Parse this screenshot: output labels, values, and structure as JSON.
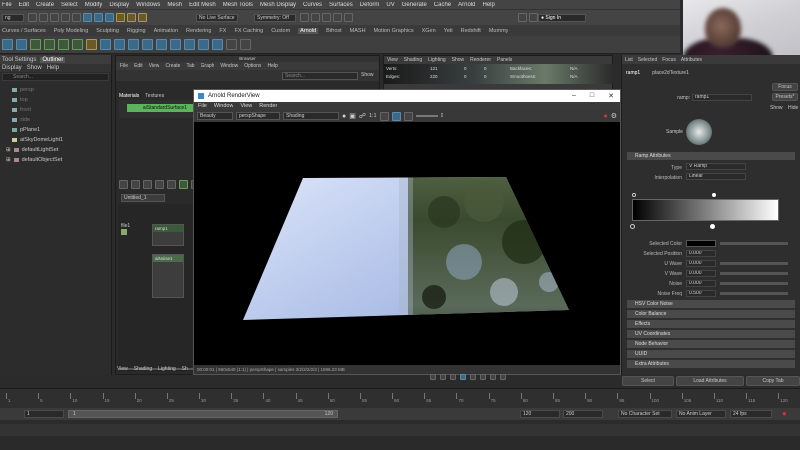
{
  "menubar": [
    "File",
    "Edit",
    "Create",
    "Select",
    "Modify",
    "Display",
    "Windows",
    "Mesh",
    "Edit Mesh",
    "Mesh Tools",
    "Mesh Display",
    "Curves",
    "Surfaces",
    "Deform",
    "UV",
    "Generate",
    "Cache",
    "Arnold",
    "Help"
  ],
  "status": {
    "workspace": "ng",
    "live_surface": "No Live Surface",
    "symmetry": "Symmetry: Off",
    "sign_in": "Sign In"
  },
  "shelf_tabs": [
    "Curves / Surfaces",
    "Poly Modeling",
    "Sculpting",
    "Rigging",
    "Animation",
    "Rendering",
    "FX",
    "FX Caching",
    "Custom",
    "Arnold",
    "Bifrost",
    "MASH",
    "Motion Graphics",
    "XGen",
    "Yeti",
    "Redshift",
    "Mummy"
  ],
  "shelf_active": "Arnold",
  "outliner": {
    "tabs": [
      "Tool Settings",
      "Outliner"
    ],
    "menu": [
      "Display",
      "Show",
      "Help"
    ],
    "search_placeholder": "Search...",
    "items": [
      "persp",
      "top",
      "front",
      "side",
      "pPlane1",
      "aiSkyDomeLight1",
      "defaultLightSet",
      "defaultObjectSet"
    ]
  },
  "hypershade": {
    "title": "Browser",
    "menu": [
      "File",
      "Edit",
      "View",
      "Create",
      "Tab",
      "Graph",
      "Window",
      "Options",
      "Help"
    ],
    "search_placeholder": "Search...",
    "show_label": "Show",
    "browser_tabs": [
      "Materials",
      "Textures"
    ],
    "material": "aiStandardSurface1",
    "graph_tab": "Untitled_1",
    "nodes": {
      "file": "file1",
      "ramp": "ramp1",
      "noise": "aiNoise1"
    }
  },
  "viewport": {
    "menu": [
      "View",
      "Shading",
      "Lighting",
      "Show",
      "Renderer",
      "Panels"
    ],
    "stats": [
      {
        "label": "Verts:",
        "a": "121",
        "b": "0",
        "c": "0",
        "d": "Backfaces:",
        "e": "N/A"
      },
      {
        "label": "Edges:",
        "a": "220",
        "b": "0",
        "c": "0",
        "d": "Smoothness:",
        "e": "N/A"
      }
    ],
    "bottom_menu": [
      "View",
      "Shading",
      "Lighting",
      "Sh"
    ]
  },
  "render_view": {
    "title": "Arnold RenderView",
    "menu": [
      "File",
      "Window",
      "View",
      "Render"
    ],
    "aov": "Beauty",
    "camera": "perspShape",
    "mode": "Shading",
    "ratio": "1:1",
    "exposure": "0",
    "status": "00:00:01 | 960x540 (1:1) | perspShape | samples 3/2/2/2/2/2 | 1596.23 MB"
  },
  "attr_editor": {
    "menu": [
      "List",
      "Selected",
      "Focus",
      "Attributes"
    ],
    "tabs": [
      "ramp1",
      "place2dTexture1"
    ],
    "node_label": "ramp:",
    "node_name": "ramp1",
    "focus": "Focus",
    "presets": "Presets*",
    "show": "Show",
    "hide": "Hide",
    "sample_label": "Sample",
    "ramp_section": "Ramp Attributes",
    "type_label": "Type",
    "type_value": "V Ramp",
    "interp_label": "Interpolation",
    "interp_value": "Linear",
    "fields": [
      {
        "label": "Selected Color",
        "value": ""
      },
      {
        "label": "Selected Position",
        "value": "0.000"
      },
      {
        "label": "U Wave",
        "value": "0.000"
      },
      {
        "label": "V Wave",
        "value": "0.000"
      },
      {
        "label": "Noise",
        "value": "0.000"
      },
      {
        "label": "Noise Freq",
        "value": "0.500"
      }
    ],
    "sections": [
      "HSV Color Noise",
      "Color Balance",
      "Effects",
      "UV Coordinates",
      "Node Behavior",
      "UUID",
      "Extra Attributes"
    ],
    "buttons": [
      "Select",
      "Load Attributes",
      "Copy Tab"
    ]
  },
  "timeline": {
    "ticks": [
      "1",
      "5",
      "10",
      "15",
      "20",
      "25",
      "30",
      "35",
      "40",
      "45",
      "50",
      "55",
      "60",
      "65",
      "70",
      "75",
      "80",
      "85",
      "90",
      "95",
      "100",
      "105",
      "110",
      "115",
      "120"
    ],
    "range_start": "1",
    "range_inner_start": "1",
    "range_inner_end": "120",
    "range_end": "120",
    "anim_end": "200",
    "character_set": "No Character Set",
    "anim_layer": "No Anim Layer",
    "fps": "24 fps"
  }
}
